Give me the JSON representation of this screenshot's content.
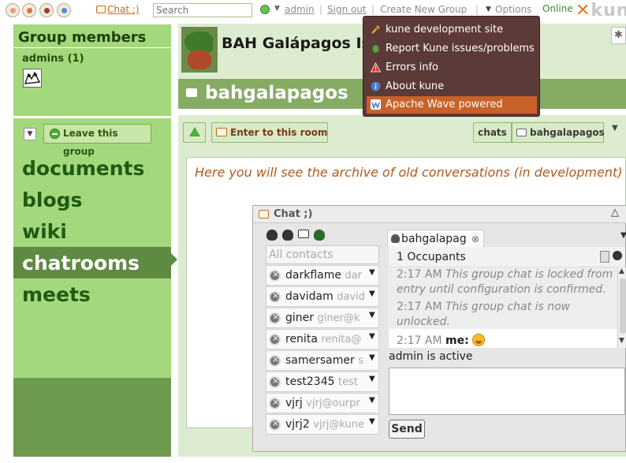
{
  "topbar": {
    "chat_link": "Chat ;)",
    "search_placeholder": "Search",
    "user": "admin",
    "signout": "Sign out",
    "create_group": "Create New Group",
    "options": "Options",
    "online": "Online",
    "logo_main": "kun"
  },
  "sidebar": {
    "title": "Group members",
    "admins": "admins (1)",
    "leave": "Leave this group",
    "tools": [
      "documents",
      "blogs",
      "wiki",
      "chatrooms",
      "meets"
    ],
    "selected_tool": "chatrooms"
  },
  "header": {
    "group_title": "BAH Galápagos Is",
    "room_title": "bahgalapagos"
  },
  "toolbar": {
    "enter_room": "Enter to this room",
    "crumb1": "chats",
    "crumb2": "bahgalapagos"
  },
  "archive_text": "Here you will see the archive of old conversations (in development)",
  "menu": {
    "items": [
      {
        "label": "kune development site",
        "icon": "wrench-icon"
      },
      {
        "label": "Report Kune issues/problems",
        "icon": "bug-icon"
      },
      {
        "label": "Errors info",
        "icon": "warning-icon"
      },
      {
        "label": "About kune",
        "icon": "info-icon"
      },
      {
        "label": "Apache Wave powered",
        "icon": "wave-icon"
      }
    ],
    "active_index": 4
  },
  "chat": {
    "title": "Chat ;)",
    "filter_placeholder": "All contacts",
    "contacts": [
      {
        "name": "darkflame",
        "jid": "dar"
      },
      {
        "name": "davidam",
        "jid": "david"
      },
      {
        "name": "giner",
        "jid": "giner@k"
      },
      {
        "name": "renita",
        "jid": "renita@"
      },
      {
        "name": "samersamer",
        "jid": "s"
      },
      {
        "name": "test2345",
        "jid": "test"
      },
      {
        "name": "vjrj",
        "jid": "vjrj@ourpr"
      },
      {
        "name": "vjrj2",
        "jid": "vjrj@kune"
      }
    ],
    "room_tab": "bahgalapag",
    "occupants": "1 Occupants",
    "messages": [
      {
        "time": "2:17 AM",
        "text": "This group chat is locked from entry until configuration is confirmed."
      },
      {
        "time": "2:17 AM",
        "text": "This group chat is now unlocked."
      },
      {
        "time": "2:17 AM",
        "sender": "me:",
        "text": ""
      }
    ],
    "status": "admin is active",
    "send": "Send"
  }
}
